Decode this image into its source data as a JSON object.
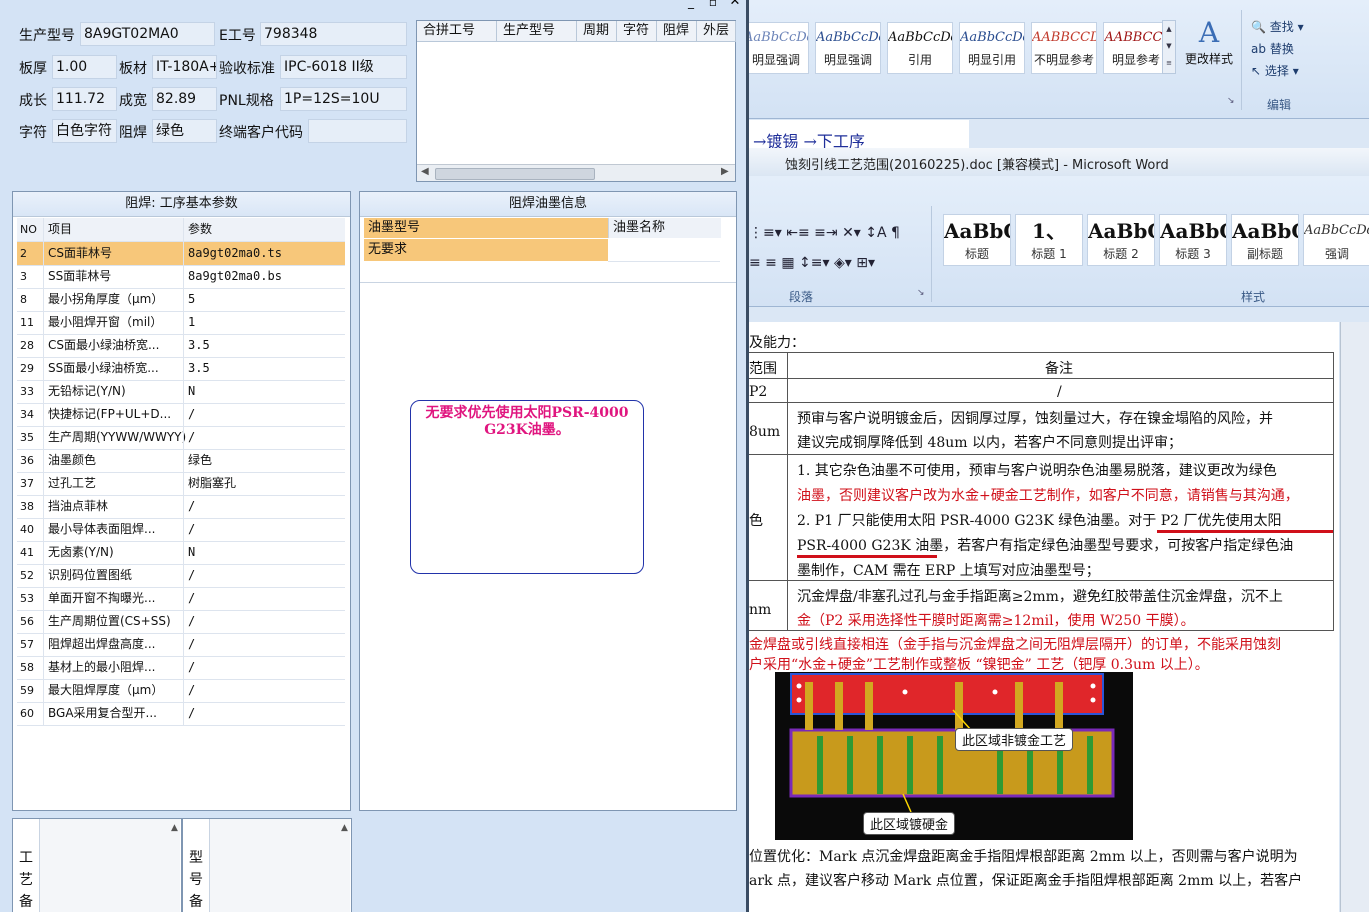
{
  "erp": {
    "window_controls": [
      "_",
      "▫",
      "✕"
    ],
    "fields": {
      "model_label": "生产型号",
      "model_value": "8A9GT02MA0",
      "eno_label": "E工号",
      "eno_value": "798348",
      "thickness_label": "板厚",
      "thickness_value": "1.00",
      "material_label": "板材",
      "material_value": "IT-180A+",
      "standard_label": "验收标准",
      "standard_value": "IPC-6018 II级",
      "length_label": "成长",
      "length_value": "111.72",
      "width_label": "成宽",
      "width_value": "82.89",
      "pnl_label": "PNL规格",
      "pnl_value": "1P=12S=10U",
      "char_label": "字符",
      "char_value": "白色字符",
      "mask_label": "阻焊",
      "mask_value": "绿色",
      "customer_label": "终端客户代码",
      "customer_value": ""
    },
    "top_table_headers": [
      "合拼工号",
      "生产型号",
      "周期",
      "字符",
      "阻焊",
      "外层"
    ],
    "params_group": {
      "title": "阻焊: 工序基本参数",
      "headers": [
        "NO",
        "项目",
        "参数"
      ],
      "rows": [
        {
          "no": "2",
          "item": "CS面菲林号",
          "param": "8a9gt02ma0.ts"
        },
        {
          "no": "3",
          "item": "SS面菲林号",
          "param": "8a9gt02ma0.bs"
        },
        {
          "no": "8",
          "item": "最小拐角厚度（μm）",
          "param": "5"
        },
        {
          "no": "11",
          "item": "最小阻焊开窗（mil）",
          "param": "1"
        },
        {
          "no": "28",
          "item": "CS面最小绿油桥宽...",
          "param": "3.5"
        },
        {
          "no": "29",
          "item": "SS面最小绿油桥宽...",
          "param": "3.5"
        },
        {
          "no": "33",
          "item": "无铅标记(Y/N)",
          "param": "N"
        },
        {
          "no": "34",
          "item": "快捷标记(FP+UL+D...",
          "param": "/"
        },
        {
          "no": "35",
          "item": "生产周期(YYWW/WWYY)",
          "param": "/"
        },
        {
          "no": "36",
          "item": "油墨颜色",
          "param": "绿色"
        },
        {
          "no": "37",
          "item": "过孔工艺",
          "param": "树脂塞孔"
        },
        {
          "no": "38",
          "item": "挡油点菲林",
          "param": "/"
        },
        {
          "no": "40",
          "item": "最小导体表面阻焊...",
          "param": "/"
        },
        {
          "no": "41",
          "item": "无卤素(Y/N)",
          "param": "N"
        },
        {
          "no": "52",
          "item": "识别码位置图纸",
          "param": "/"
        },
        {
          "no": "53",
          "item": "单面开窗不掏曝光...",
          "param": "/"
        },
        {
          "no": "56",
          "item": "生产周期位置(CS+SS)",
          "param": "/"
        },
        {
          "no": "57",
          "item": "阻焊超出焊盘高度...",
          "param": "/"
        },
        {
          "no": "58",
          "item": "基材上的最小阻焊...",
          "param": "/"
        },
        {
          "no": "59",
          "item": "最大阻焊厚度（μm）",
          "param": "/"
        },
        {
          "no": "60",
          "item": "BGA采用复合型开...",
          "param": "/"
        }
      ]
    },
    "ink_group": {
      "title": "阻焊油墨信息",
      "headers": [
        "油墨型号",
        "油墨名称"
      ],
      "rows": [
        {
          "model": "无要求",
          "name": ""
        }
      ]
    },
    "note_text": "无要求优先使用太阳PSR-4000 G23K油墨。",
    "bottom_labels": [
      "工艺备注",
      "型号备注"
    ]
  },
  "word": {
    "title": "蚀刻引线工艺范围(20160225).doc [兼容模式] - Microsoft Word",
    "top_styles": [
      {
        "preview": "AaBbCcDd",
        "name": "明显强调"
      },
      {
        "preview": "AaBbCcDd",
        "name": "明显强调"
      },
      {
        "preview": "AaBbCcDd",
        "name": "引用"
      },
      {
        "preview": "AaBbCcDd",
        "name": "明显引用"
      },
      {
        "preview": "AABBCCDD",
        "name": "不明显参考"
      },
      {
        "preview": "AABBCCI",
        "name": "明显参考"
      }
    ],
    "change_styles": "更改样式",
    "edit_items": [
      "查找",
      "替换",
      "选择"
    ],
    "edit_group": "编辑",
    "bg_text": "→镀锡 →下工序",
    "styles2": [
      {
        "preview": "AaBbC",
        "name": "标题"
      },
      {
        "preview": "1、",
        "name": "标题 1"
      },
      {
        "preview": "AaBbC",
        "name": "标题 2"
      },
      {
        "preview": "AaBbC",
        "name": "标题 3"
      },
      {
        "preview": "AaBbC",
        "name": "副标题"
      },
      {
        "preview": "AaBbCcDd",
        "name": "强调"
      }
    ],
    "group_paragraph": "段落",
    "group_styles": "样式",
    "doc": {
      "intro": "及能力：",
      "col1_header": "范围",
      "col2_header": "备注",
      "row1_left": "P2",
      "row1_right": "/",
      "row2_left": "8um",
      "row2_lines": [
        "预审与客户说明镀金后，因铜厚过厚，蚀刻量过大，存在镍金塌陷的风险，并",
        "建议完成铜厚降低到 48um 以内，若客户不同意则提出评审；"
      ],
      "row3_left": "色",
      "row3_lines": [
        "1. 其它杂色油墨不可使用，预审与客户说明杂色油墨易脱落，建议更改为绿色",
        "油墨，否则建议客户改为水金+硬金工艺制作，如客户不同意，请销售与其沟通，",
        "2. P1 厂只能使用太阳 PSR-4000 G23K 绿色油墨。对于 P2 厂优先使用太阳",
        "PSR-4000 G23K 油墨，若客户有指定绿色油墨型号要求，可按客户指定绿色油",
        "墨制作，CAM 需在 ERP 上填写对应油墨型号；"
      ],
      "row4_left": "nm",
      "row4_lines": [
        "沉金焊盘/非塞孔过孔与金手指距离≥2mm，避免红胶带盖住沉金焊盘，沉不上",
        "金（P2 采用选择性干膜时距离需≥12mil，使用 W250 干膜）。"
      ],
      "red_para": [
        "金焊盘或引线直接相连（金手指与沉金焊盘之间无阻焊层隔开）的订单，不能采用蚀刻",
        "户采用“水金+硬金”工艺制作或整板 “镍钯金” 工艺（钯厚 0.3um 以上）。"
      ],
      "callout_top": "此区域非镀金工艺",
      "callout_bottom": "此区域镀硬金",
      "bottom_lines": [
        "位置优化：Mark 点沉金焊盘距离金手指阻焊根部距离 2mm 以上，否则需与客户说明为",
        "ark 点，建议客户移动 Mark 点位置，保证距离金手指阻焊根部距离 2mm 以上，若客户"
      ]
    }
  }
}
